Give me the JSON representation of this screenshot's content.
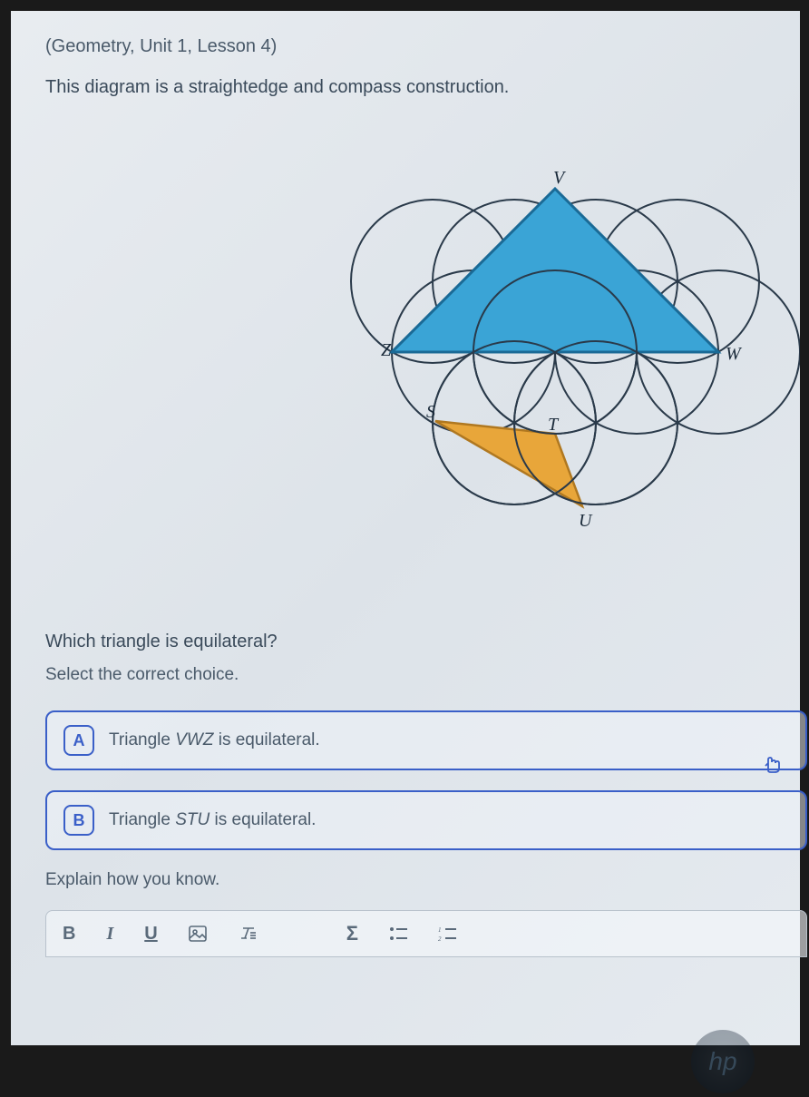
{
  "breadcrumb": "(Geometry, Unit 1, Lesson 4)",
  "intro": "This diagram is a straightedge and compass construction.",
  "diagram": {
    "labels": {
      "V": "V",
      "W": "W",
      "Z": "Z",
      "S": "S",
      "T": "T",
      "U": "U"
    },
    "colors": {
      "triangle_vwz": "#3aa4d6",
      "triangle_stu": "#e8a63a",
      "stroke": "#2a3a4a"
    }
  },
  "question": "Which triangle is equilateral?",
  "instruction": "Select the correct choice.",
  "choices": [
    {
      "letter": "A",
      "prefix": "Triangle ",
      "var": "VWZ",
      "suffix": " is equilateral."
    },
    {
      "letter": "B",
      "prefix": "Triangle ",
      "var": "STU",
      "suffix": " is equilateral."
    }
  ],
  "explain_label": "Explain how you know.",
  "toolbar": {
    "bold": "B",
    "italic": "I",
    "underline": "U",
    "image": "image-icon",
    "clear": "clear-format-icon",
    "sigma": "Σ",
    "bullets": "bullet-list-icon",
    "numbers": "number-list-icon"
  },
  "logo": "hp"
}
